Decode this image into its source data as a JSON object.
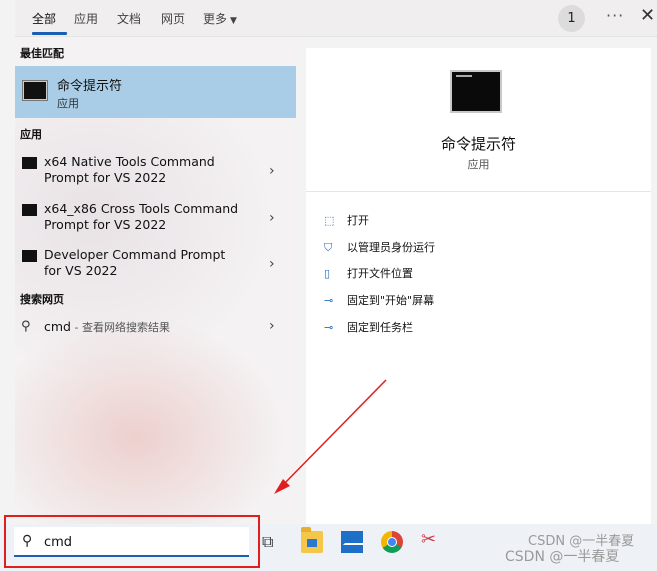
{
  "tabs": [
    {
      "label": "全部"
    },
    {
      "label": "应用"
    },
    {
      "label": "文档"
    },
    {
      "label": "网页"
    },
    {
      "label": "更多"
    }
  ],
  "header": {
    "badge": "1",
    "more": "···",
    "close": "✕"
  },
  "left": {
    "best_match_heading": "最佳匹配",
    "best_match": {
      "title": "命令提示符",
      "subtitle": "应用"
    },
    "apps_heading": "应用",
    "apps": [
      {
        "label": "x64 Native Tools Command Prompt for VS 2022"
      },
      {
        "label": "x64_x86 Cross Tools Command Prompt for VS 2022"
      },
      {
        "label": "Developer Command Prompt for VS 2022"
      }
    ],
    "web_heading": "搜索网页",
    "web": {
      "query": "cmd",
      "suffix": " - 查看网络搜索结果"
    }
  },
  "detail": {
    "title": "命令提示符",
    "subtitle": "应用",
    "actions": [
      {
        "icon": "open-icon",
        "label": "打开"
      },
      {
        "icon": "admin-shield-icon",
        "label": "以管理员身份运行"
      },
      {
        "icon": "folder-location-icon",
        "label": "打开文件位置"
      },
      {
        "icon": "pin-icon",
        "label": "固定到\"开始\"屏幕"
      },
      {
        "icon": "pin-taskbar-icon",
        "label": "固定到任务栏"
      }
    ]
  },
  "search": {
    "value": "cmd"
  },
  "watermarks": [
    "CSDN @一半春夏",
    "CSDN @一半春夏"
  ],
  "colors": {
    "accent": "#1b5fb3",
    "selection": "#a9cde6",
    "highlight_box": "#e01e1e"
  }
}
